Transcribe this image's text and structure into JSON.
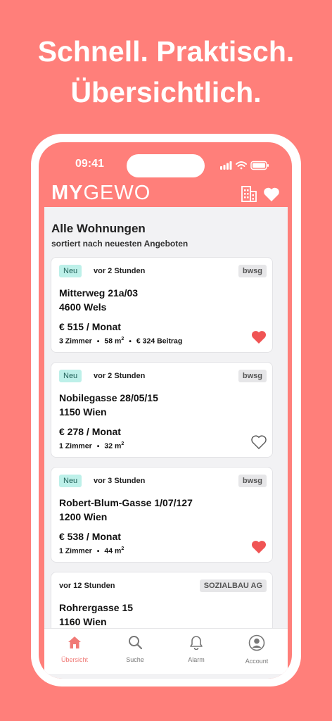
{
  "headline": {
    "line1": "Schnell. Praktisch.",
    "line2": "Übersichtlich."
  },
  "status_bar": {
    "time": "09:41"
  },
  "app": {
    "logo_bold": "MY",
    "logo_light": "GEWO",
    "header_icons": [
      "building-icon",
      "heart-icon"
    ]
  },
  "list": {
    "title": "Alle Wohnungen",
    "subtitle": "sortiert nach neuesten Angeboten",
    "items": [
      {
        "badge": "Neu",
        "time": "vor 2 Stunden",
        "provider": "bwsg",
        "street": "Mitterweg 21a/03",
        "city": "4600 Wels",
        "price": "€ 515 / Monat",
        "rooms": "3 Zimmer",
        "size": "58 m",
        "size_sup": "2",
        "extra": "€ 324 Beitrag",
        "favorite": true
      },
      {
        "badge": "Neu",
        "time": "vor 2 Stunden",
        "provider": "bwsg",
        "street": "Nobilegasse 28/05/15",
        "city": "1150 Wien",
        "price": "€ 278 / Monat",
        "rooms": "1 Zimmer",
        "size": "32 m",
        "size_sup": "2",
        "favorite": false
      },
      {
        "badge": "Neu",
        "time": "vor 3 Stunden",
        "provider": "bwsg",
        "street": "Robert-Blum-Gasse 1/07/127",
        "city": "1200 Wien",
        "price": "€ 538 / Monat",
        "rooms": "1 Zimmer",
        "size": "44 m",
        "size_sup": "2",
        "favorite": true
      },
      {
        "time": "vor 12 Stunden",
        "provider": "SOZIALBAU AG",
        "street": "Rohrergasse 15",
        "city": "1160 Wien"
      }
    ]
  },
  "tabs": [
    {
      "label": "Übersicht",
      "icon": "home-icon",
      "active": true
    },
    {
      "label": "Suche",
      "icon": "search-icon",
      "active": false
    },
    {
      "label": "Alarm",
      "icon": "bell-icon",
      "active": false
    },
    {
      "label": "Account",
      "icon": "account-icon",
      "active": false
    }
  ],
  "colors": {
    "brand": "#FF7F7A",
    "heart": "#F05454",
    "badge_new_bg": "#BDF0E9"
  }
}
